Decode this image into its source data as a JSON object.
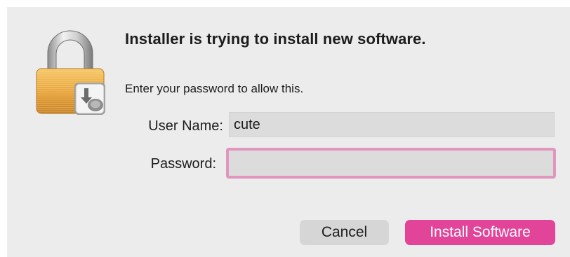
{
  "dialog": {
    "title": "Installer is trying to install new software.",
    "message": "Enter your password to allow this.",
    "icon": "lock-with-installer-icon"
  },
  "form": {
    "username_label": "User Name:",
    "username_value": "cute",
    "password_label": "Password:",
    "password_value": ""
  },
  "buttons": {
    "cancel_label": "Cancel",
    "install_label": "Install Software"
  },
  "colors": {
    "accent": "#e2449a",
    "focus_ring": "#e196bd",
    "dialog_background": "#ececec",
    "lock_body": "#e9a53a"
  }
}
